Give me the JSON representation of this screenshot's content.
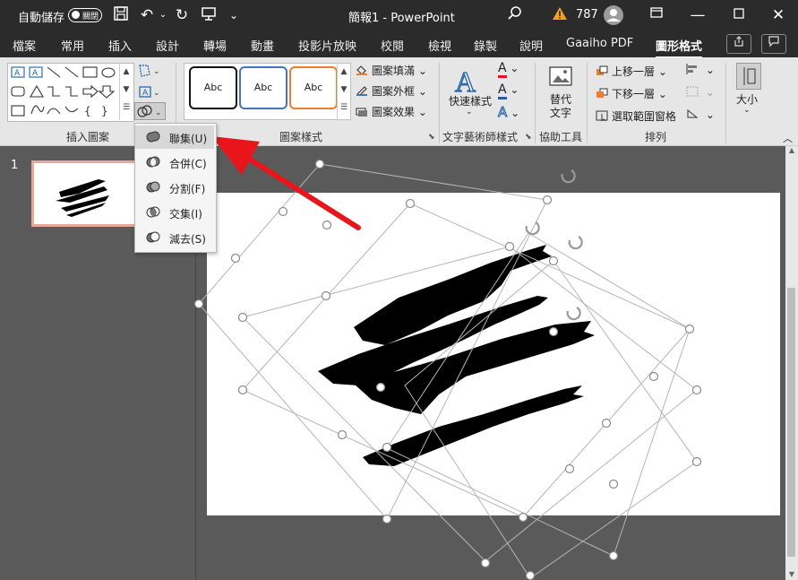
{
  "titlebar": {
    "autosave_label": "自動儲存",
    "autosave_state": "關閉",
    "doc_title": "簡報1  -  PowerPoint",
    "warning_count": "787"
  },
  "tabs": [
    "檔案",
    "常用",
    "插入",
    "設計",
    "轉場",
    "動畫",
    "投影片放映",
    "校閱",
    "檢視",
    "錄製",
    "說明",
    "Gaaiho PDF",
    "圖形格式"
  ],
  "ribbon": {
    "groups": {
      "insert_shapes": "插入圖案",
      "shape_styles": "圖案樣式",
      "wordart_styles": "文字藝術師樣式",
      "accessibility": "協助工具",
      "arrange": "排列"
    },
    "style_samples": [
      "Abc",
      "Abc",
      "Abc"
    ],
    "shape_fill": "圖案填滿",
    "shape_outline": "圖案外框",
    "shape_effects": "圖案效果",
    "quick_styles": "快速樣式",
    "alt_text": "替代文字",
    "bring_forward": "上移一層",
    "send_backward": "下移一層",
    "selection_pane": "選取範圍窗格",
    "size": "大小",
    "letter_a": "A"
  },
  "merge_menu": {
    "items": [
      "聯集(U)",
      "合併(C)",
      "分割(F)",
      "交集(I)",
      "減去(S)"
    ]
  },
  "slides": {
    "current_number": "1"
  },
  "colors": {
    "accent_red": "#e8161b",
    "titlebar": "#2b2b2b",
    "ribbon": "#e6e6e6"
  }
}
